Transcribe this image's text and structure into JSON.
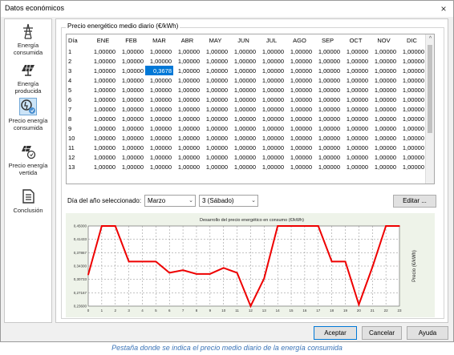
{
  "window": {
    "title": "Datos económicos",
    "close_glyph": "×"
  },
  "sidebar": {
    "items": [
      {
        "label": "Energía consumida",
        "icon": "transmission-tower-icon",
        "selected": false
      },
      {
        "label": "Energía producida",
        "icon": "solar-panel-icon",
        "selected": false
      },
      {
        "label": "Precio energía consumida",
        "icon": "price-consumed-icon",
        "selected": true
      },
      {
        "label": "Precio energía vertida",
        "icon": "price-exported-icon",
        "selected": false
      },
      {
        "label": "Conclusión",
        "icon": "document-icon",
        "selected": false
      }
    ]
  },
  "group": {
    "title": "Precio energético medio diario (€/kWh)"
  },
  "grid": {
    "headers": [
      "Día",
      "ENE",
      "FEB",
      "MAR",
      "ABR",
      "MAY",
      "JUN",
      "JUL",
      "AGO",
      "SEP",
      "OCT",
      "NOV",
      "DIC"
    ],
    "rows": [
      [
        "1",
        "1,00000",
        "1,00000",
        "1,00000",
        "1,00000",
        "1,00000",
        "1,00000",
        "1,00000",
        "1,00000",
        "1,00000",
        "1,00000",
        "1,00000",
        "1,00000"
      ],
      [
        "2",
        "1,00000",
        "1,00000",
        "1,00000",
        "1,00000",
        "1,00000",
        "1,00000",
        "1,00000",
        "1,00000",
        "1,00000",
        "1,00000",
        "1,00000",
        "1,00000"
      ],
      [
        "3",
        "1,00000",
        "1,00000",
        "0,3678",
        "1,00000",
        "1,00000",
        "1,00000",
        "1,00000",
        "1,00000",
        "1,00000",
        "1,00000",
        "1,00000",
        "1,00000"
      ],
      [
        "4",
        "1,00000",
        "1,00000",
        "1,00000",
        "1,00000",
        "1,00000",
        "1,00000",
        "1,00000",
        "1,00000",
        "1,00000",
        "1,00000",
        "1,00000",
        "1,00000"
      ],
      [
        "5",
        "1,00000",
        "1,00000",
        "1,00000",
        "1,00000",
        "1,00000",
        "1,00000",
        "1,00000",
        "1,00000",
        "1,00000",
        "1,00000",
        "1,00000",
        "1,00000"
      ],
      [
        "6",
        "1,00000",
        "1,00000",
        "1,00000",
        "1,00000",
        "1,00000",
        "1,00000",
        "1,00000",
        "1,00000",
        "1,00000",
        "1,00000",
        "1,00000",
        "1,00000"
      ],
      [
        "7",
        "1,00000",
        "1,00000",
        "1,00000",
        "1,00000",
        "1,00000",
        "1,00000",
        "1,00000",
        "1,00000",
        "1,00000",
        "1,00000",
        "1,00000",
        "1,00000"
      ],
      [
        "8",
        "1,00000",
        "1,00000",
        "1,00000",
        "1,00000",
        "1,00000",
        "1,00000",
        "1,00000",
        "1,00000",
        "1,00000",
        "1,00000",
        "1,00000",
        "1,00000"
      ],
      [
        "9",
        "1,00000",
        "1,00000",
        "1,00000",
        "1,00000",
        "1,00000",
        "1,00000",
        "1,00000",
        "1,00000",
        "1,00000",
        "1,00000",
        "1,00000",
        "1,00000"
      ],
      [
        "10",
        "1,00000",
        "1,00000",
        "1,00000",
        "1,00000",
        "1,00000",
        "1,00000",
        "1,00000",
        "1,00000",
        "1,00000",
        "1,00000",
        "1,00000",
        "1,00000"
      ],
      [
        "11",
        "1,00000",
        "1,00000",
        "1,00000",
        "1,00000",
        "1,00000",
        "1,00000",
        "1,00000",
        "1,00000",
        "1,00000",
        "1,00000",
        "1,00000",
        "1,00000"
      ],
      [
        "12",
        "1,00000",
        "1,00000",
        "1,00000",
        "1,00000",
        "1,00000",
        "1,00000",
        "1,00000",
        "1,00000",
        "1,00000",
        "1,00000",
        "1,00000",
        "1,00000"
      ],
      [
        "13",
        "1,00000",
        "1,00000",
        "1,00000",
        "1,00000",
        "1,00000",
        "1,00000",
        "1,00000",
        "1,00000",
        "1,00000",
        "1,00000",
        "1,00000",
        "1,00000"
      ]
    ],
    "selected_cell": {
      "row": 2,
      "col": 3
    },
    "scroll_up_glyph": "^"
  },
  "day_selector": {
    "label": "Día del año seleccionado:",
    "month_value": "Marzo",
    "day_value": "3 (Sábado)",
    "arrow_glyph": "⌄"
  },
  "edit_button": {
    "label": "Editar ..."
  },
  "chart_data": {
    "type": "line",
    "title": "Desarrollo del precio energético en consumo (€/kWh)",
    "ylabel": "Precio (€/kWh)",
    "xlabel": "",
    "x": [
      0,
      1,
      2,
      3,
      4,
      5,
      6,
      7,
      8,
      9,
      10,
      11,
      12,
      13,
      14,
      15,
      16,
      17,
      18,
      19,
      20,
      21,
      22,
      23
    ],
    "x_ticks": [
      "0",
      "1",
      "2",
      "3",
      "4",
      "5",
      "6",
      "7",
      "8",
      "9",
      "10",
      "11",
      "12",
      "13",
      "14",
      "15",
      "16",
      "17",
      "18",
      "19",
      "20",
      "21",
      "22",
      "23"
    ],
    "y_ticks": [
      "0,45000",
      "0,41433",
      "0,37867",
      "0,34300",
      "0,30733",
      "0,27167",
      "0,23600"
    ],
    "ylim": [
      0.236,
      0.45
    ],
    "series": [
      {
        "color": "#ee0000",
        "values": [
          0.32,
          0.45,
          0.45,
          0.355,
          0.355,
          0.355,
          0.325,
          0.332,
          0.322,
          0.322,
          0.338,
          0.325,
          0.236,
          0.31,
          0.45,
          0.45,
          0.45,
          0.45,
          0.355,
          0.355,
          0.24,
          0.34,
          0.45,
          0.45
        ]
      }
    ],
    "grid": true,
    "background": "#eef3e9",
    "plot_background": "#ffffff"
  },
  "footer_buttons": {
    "accept": "Aceptar",
    "cancel": "Cancelar",
    "help": "Ayuda"
  },
  "caption": "Pestaña donde se indica el precio medio diario de la energía consumida"
}
